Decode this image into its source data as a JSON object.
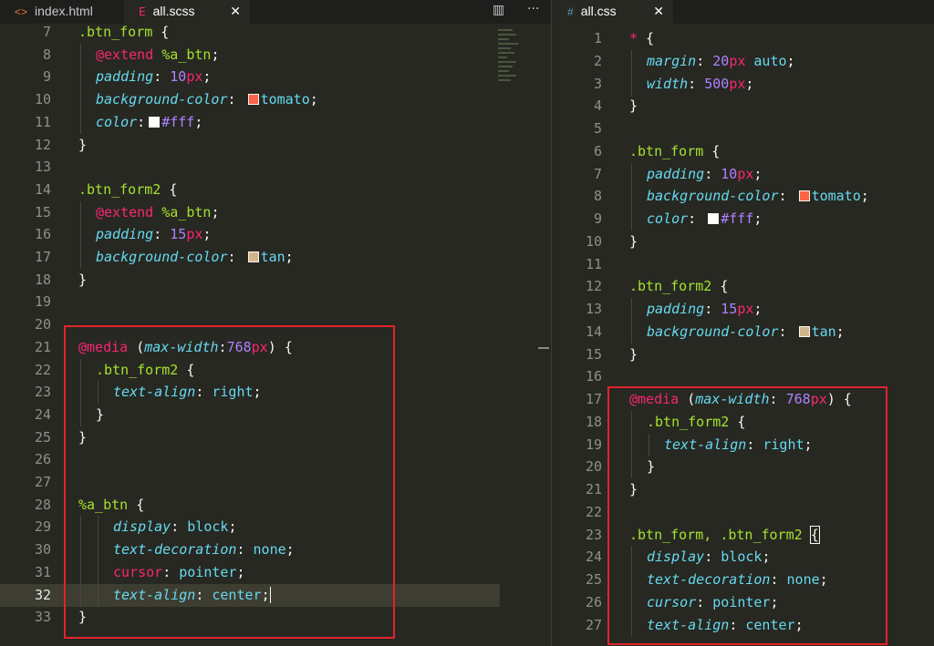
{
  "tabs_left": [
    {
      "label": "index.html",
      "icon": "code-icon",
      "active": false
    },
    {
      "label": "all.scss",
      "icon": "scss-file-icon",
      "active": true,
      "close": "✕"
    }
  ],
  "tabs_right": [
    {
      "label": "all.css",
      "icon": "hash-icon",
      "active": true,
      "close": "✕"
    }
  ],
  "toolbar": {
    "split_icon": "▥",
    "more_icon": "···"
  },
  "colors": {
    "tomato": "#ff6347",
    "white": "#ffffff",
    "tan": "#d2b48c",
    "highlight": "#e0232a"
  },
  "left_editor": {
    "current_line": 32,
    "lines": [
      {
        "n": "7",
        "indent": 0,
        "tokens": [
          {
            "t": ".btn_form",
            "c": "sel"
          },
          {
            "t": " {",
            "c": "punc"
          }
        ]
      },
      {
        "n": "8",
        "indent": 1,
        "tokens": [
          {
            "t": "@extend",
            "c": "kw"
          },
          {
            "t": " ",
            "c": "txt"
          },
          {
            "t": "%a_btn",
            "c": "ph"
          },
          {
            "t": ";",
            "c": "punc"
          }
        ]
      },
      {
        "n": "9",
        "indent": 1,
        "tokens": [
          {
            "t": "padding",
            "c": "prop"
          },
          {
            "t": ": ",
            "c": "punc"
          },
          {
            "t": "10",
            "c": "num"
          },
          {
            "t": "px",
            "c": "unit"
          },
          {
            "t": ";",
            "c": "punc"
          }
        ]
      },
      {
        "n": "10",
        "indent": 1,
        "tokens": [
          {
            "t": "background-color",
            "c": "prop"
          },
          {
            "t": ": ",
            "c": "punc"
          },
          {
            "sw": "tomato"
          },
          {
            "t": "tomato",
            "c": "val"
          },
          {
            "t": ";",
            "c": "punc"
          }
        ]
      },
      {
        "n": "11",
        "indent": 1,
        "tokens": [
          {
            "t": "color",
            "c": "prop"
          },
          {
            "t": ":",
            "c": "punc"
          },
          {
            "sw": "white"
          },
          {
            "t": "#fff",
            "c": "num"
          },
          {
            "t": ";",
            "c": "punc"
          }
        ]
      },
      {
        "n": "12",
        "indent": 0,
        "tokens": [
          {
            "t": "}",
            "c": "punc"
          }
        ]
      },
      {
        "n": "13",
        "indent": 0,
        "tokens": []
      },
      {
        "n": "14",
        "indent": 0,
        "tokens": [
          {
            "t": ".btn_form2",
            "c": "sel"
          },
          {
            "t": " {",
            "c": "punc"
          }
        ]
      },
      {
        "n": "15",
        "indent": 1,
        "tokens": [
          {
            "t": "@extend",
            "c": "kw"
          },
          {
            "t": " ",
            "c": "txt"
          },
          {
            "t": "%a_btn",
            "c": "ph"
          },
          {
            "t": ";",
            "c": "punc"
          }
        ]
      },
      {
        "n": "16",
        "indent": 1,
        "tokens": [
          {
            "t": "padding",
            "c": "prop"
          },
          {
            "t": ": ",
            "c": "punc"
          },
          {
            "t": "15",
            "c": "num"
          },
          {
            "t": "px",
            "c": "unit"
          },
          {
            "t": ";",
            "c": "punc"
          }
        ]
      },
      {
        "n": "17",
        "indent": 1,
        "tokens": [
          {
            "t": "background-color",
            "c": "prop"
          },
          {
            "t": ": ",
            "c": "punc"
          },
          {
            "sw": "tan"
          },
          {
            "t": "tan",
            "c": "val"
          },
          {
            "t": ";",
            "c": "punc"
          }
        ]
      },
      {
        "n": "18",
        "indent": 0,
        "tokens": [
          {
            "t": "}",
            "c": "punc"
          }
        ]
      },
      {
        "n": "19",
        "indent": 0,
        "tokens": []
      },
      {
        "n": "20",
        "indent": 0,
        "tokens": []
      },
      {
        "n": "21",
        "indent": 0,
        "tokens": [
          {
            "t": "@media",
            "c": "kw"
          },
          {
            "t": " (",
            "c": "punc"
          },
          {
            "t": "max-width",
            "c": "prop"
          },
          {
            "t": ":",
            "c": "punc"
          },
          {
            "t": "768",
            "c": "num"
          },
          {
            "t": "px",
            "c": "unit"
          },
          {
            "t": ") {",
            "c": "punc"
          }
        ]
      },
      {
        "n": "22",
        "indent": 1,
        "tokens": [
          {
            "t": ".btn_form2",
            "c": "sel"
          },
          {
            "t": " {",
            "c": "punc"
          }
        ]
      },
      {
        "n": "23",
        "indent": 2,
        "tokens": [
          {
            "t": "text-align",
            "c": "prop"
          },
          {
            "t": ": ",
            "c": "punc"
          },
          {
            "t": "right",
            "c": "val"
          },
          {
            "t": ";",
            "c": "punc"
          }
        ]
      },
      {
        "n": "24",
        "indent": 1,
        "tokens": [
          {
            "t": "}",
            "c": "punc"
          }
        ]
      },
      {
        "n": "25",
        "indent": 0,
        "tokens": [
          {
            "t": "}",
            "c": "punc"
          }
        ]
      },
      {
        "n": "26",
        "indent": 0,
        "tokens": []
      },
      {
        "n": "27",
        "indent": 0,
        "tokens": []
      },
      {
        "n": "28",
        "indent": 0,
        "tokens": [
          {
            "t": "%a_btn",
            "c": "ph"
          },
          {
            "t": " {",
            "c": "punc"
          }
        ]
      },
      {
        "n": "29",
        "indent": 2,
        "tokens": [
          {
            "t": "display",
            "c": "prop"
          },
          {
            "t": ": ",
            "c": "punc"
          },
          {
            "t": "block",
            "c": "val"
          },
          {
            "t": ";",
            "c": "punc"
          }
        ]
      },
      {
        "n": "30",
        "indent": 2,
        "tokens": [
          {
            "t": "text-decoration",
            "c": "prop"
          },
          {
            "t": ": ",
            "c": "punc"
          },
          {
            "t": "none",
            "c": "val"
          },
          {
            "t": ";",
            "c": "punc"
          }
        ]
      },
      {
        "n": "31",
        "indent": 2,
        "tokens": [
          {
            "t": "cursor",
            "c": "kw"
          },
          {
            "t": ": ",
            "c": "punc"
          },
          {
            "t": "pointer",
            "c": "val"
          },
          {
            "t": ";",
            "c": "punc"
          }
        ]
      },
      {
        "n": "32",
        "indent": 2,
        "tokens": [
          {
            "t": "text-align",
            "c": "prop"
          },
          {
            "t": ": ",
            "c": "punc"
          },
          {
            "t": "center",
            "c": "val"
          },
          {
            "t": ";",
            "c": "punc"
          },
          {
            "cursor": true
          }
        ]
      },
      {
        "n": "33",
        "indent": 0,
        "tokens": [
          {
            "t": "}",
            "c": "punc"
          }
        ]
      }
    ]
  },
  "right_editor": {
    "lines": [
      {
        "n": "1",
        "indent": 0,
        "tokens": [
          {
            "t": "*",
            "c": "kw"
          },
          {
            "t": " {",
            "c": "punc"
          }
        ]
      },
      {
        "n": "2",
        "indent": 1,
        "tokens": [
          {
            "t": "margin",
            "c": "prop"
          },
          {
            "t": ": ",
            "c": "punc"
          },
          {
            "t": "20",
            "c": "num"
          },
          {
            "t": "px",
            "c": "unit"
          },
          {
            "t": " ",
            "c": "txt"
          },
          {
            "t": "auto",
            "c": "val"
          },
          {
            "t": ";",
            "c": "punc"
          }
        ]
      },
      {
        "n": "3",
        "indent": 1,
        "tokens": [
          {
            "t": "width",
            "c": "prop"
          },
          {
            "t": ": ",
            "c": "punc"
          },
          {
            "t": "500",
            "c": "num"
          },
          {
            "t": "px",
            "c": "unit"
          },
          {
            "t": ";",
            "c": "punc"
          }
        ]
      },
      {
        "n": "4",
        "indent": 0,
        "tokens": [
          {
            "t": "}",
            "c": "punc"
          }
        ]
      },
      {
        "n": "5",
        "indent": 0,
        "tokens": []
      },
      {
        "n": "6",
        "indent": 0,
        "tokens": [
          {
            "t": ".btn_form",
            "c": "sel"
          },
          {
            "t": " {",
            "c": "punc"
          }
        ]
      },
      {
        "n": "7",
        "indent": 1,
        "tokens": [
          {
            "t": "padding",
            "c": "prop"
          },
          {
            "t": ": ",
            "c": "punc"
          },
          {
            "t": "10",
            "c": "num"
          },
          {
            "t": "px",
            "c": "unit"
          },
          {
            "t": ";",
            "c": "punc"
          }
        ]
      },
      {
        "n": "8",
        "indent": 1,
        "tokens": [
          {
            "t": "background-color",
            "c": "prop"
          },
          {
            "t": ": ",
            "c": "punc"
          },
          {
            "sw": "tomato"
          },
          {
            "t": "tomato",
            "c": "val"
          },
          {
            "t": ";",
            "c": "punc"
          }
        ]
      },
      {
        "n": "9",
        "indent": 1,
        "tokens": [
          {
            "t": "color",
            "c": "prop"
          },
          {
            "t": ": ",
            "c": "punc"
          },
          {
            "sw": "white"
          },
          {
            "t": "#fff",
            "c": "num"
          },
          {
            "t": ";",
            "c": "punc"
          }
        ]
      },
      {
        "n": "10",
        "indent": 0,
        "tokens": [
          {
            "t": "}",
            "c": "punc"
          }
        ]
      },
      {
        "n": "11",
        "indent": 0,
        "tokens": []
      },
      {
        "n": "12",
        "indent": 0,
        "tokens": [
          {
            "t": ".btn_form2",
            "c": "sel"
          },
          {
            "t": " {",
            "c": "punc"
          }
        ]
      },
      {
        "n": "13",
        "indent": 1,
        "tokens": [
          {
            "t": "padding",
            "c": "prop"
          },
          {
            "t": ": ",
            "c": "punc"
          },
          {
            "t": "15",
            "c": "num"
          },
          {
            "t": "px",
            "c": "unit"
          },
          {
            "t": ";",
            "c": "punc"
          }
        ]
      },
      {
        "n": "14",
        "indent": 1,
        "tokens": [
          {
            "t": "background-color",
            "c": "prop"
          },
          {
            "t": ": ",
            "c": "punc"
          },
          {
            "sw": "tan"
          },
          {
            "t": "tan",
            "c": "val"
          },
          {
            "t": ";",
            "c": "punc"
          }
        ]
      },
      {
        "n": "15",
        "indent": 0,
        "tokens": [
          {
            "t": "}",
            "c": "punc"
          }
        ]
      },
      {
        "n": "16",
        "indent": 0,
        "tokens": []
      },
      {
        "n": "17",
        "indent": 0,
        "tokens": [
          {
            "t": "@media",
            "c": "kw"
          },
          {
            "t": " (",
            "c": "punc"
          },
          {
            "t": "max-width",
            "c": "prop"
          },
          {
            "t": ": ",
            "c": "punc"
          },
          {
            "t": "768",
            "c": "num"
          },
          {
            "t": "px",
            "c": "unit"
          },
          {
            "t": ") {",
            "c": "punc"
          }
        ]
      },
      {
        "n": "18",
        "indent": 1,
        "tokens": [
          {
            "t": ".btn_form2",
            "c": "sel"
          },
          {
            "t": " {",
            "c": "punc"
          }
        ]
      },
      {
        "n": "19",
        "indent": 2,
        "tokens": [
          {
            "t": "text-align",
            "c": "prop"
          },
          {
            "t": ": ",
            "c": "punc"
          },
          {
            "t": "right",
            "c": "val"
          },
          {
            "t": ";",
            "c": "punc"
          }
        ]
      },
      {
        "n": "20",
        "indent": 1,
        "tokens": [
          {
            "t": "}",
            "c": "punc"
          }
        ]
      },
      {
        "n": "21",
        "indent": 0,
        "tokens": [
          {
            "t": "}",
            "c": "punc"
          }
        ]
      },
      {
        "n": "22",
        "indent": 0,
        "tokens": []
      },
      {
        "n": "23",
        "indent": 0,
        "tokens": [
          {
            "t": ".btn_form, .btn_form2",
            "c": "sel"
          },
          {
            "t": " ",
            "c": "txt"
          },
          {
            "t": "{",
            "c": "punc",
            "bm": true
          }
        ]
      },
      {
        "n": "24",
        "indent": 1,
        "tokens": [
          {
            "t": "display",
            "c": "prop"
          },
          {
            "t": ": ",
            "c": "punc"
          },
          {
            "t": "block",
            "c": "val"
          },
          {
            "t": ";",
            "c": "punc"
          }
        ]
      },
      {
        "n": "25",
        "indent": 1,
        "tokens": [
          {
            "t": "text-decoration",
            "c": "prop"
          },
          {
            "t": ": ",
            "c": "punc"
          },
          {
            "t": "none",
            "c": "val"
          },
          {
            "t": ";",
            "c": "punc"
          }
        ]
      },
      {
        "n": "26",
        "indent": 1,
        "tokens": [
          {
            "t": "cursor",
            "c": "prop"
          },
          {
            "t": ": ",
            "c": "punc"
          },
          {
            "t": "pointer",
            "c": "val"
          },
          {
            "t": ";",
            "c": "punc"
          }
        ]
      },
      {
        "n": "27",
        "indent": 1,
        "tokens": [
          {
            "t": "text-align",
            "c": "prop"
          },
          {
            "t": ": ",
            "c": "punc"
          },
          {
            "t": "center",
            "c": "val"
          },
          {
            "t": ";",
            "c": "punc"
          }
        ]
      }
    ]
  }
}
